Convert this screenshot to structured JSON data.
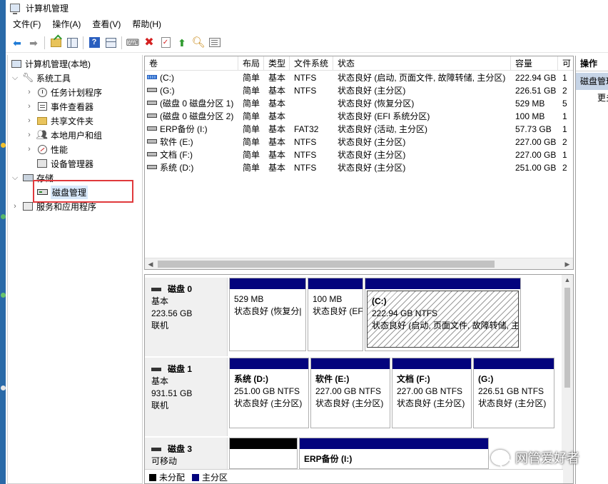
{
  "window": {
    "title": "计算机管理"
  },
  "menu": [
    "文件(F)",
    "操作(A)",
    "查看(V)",
    "帮助(H)"
  ],
  "toolbar": {
    "icons": [
      "back-arrow-icon",
      "forward-arrow-icon",
      "up-folder-icon",
      "show-hide-tree-icon",
      "help-icon",
      "show-action-pane-icon",
      "connect-icon",
      "delete-icon",
      "check-icon",
      "up-icon",
      "search-icon",
      "properties-icon"
    ]
  },
  "tree": {
    "root": "计算机管理(本地)",
    "system_tools": "系统工具",
    "task_scheduler": "任务计划程序",
    "event_viewer": "事件查看器",
    "shared_folders": "共享文件夹",
    "local_users": "本地用户和组",
    "performance": "性能",
    "device_manager": "设备管理器",
    "storage": "存储",
    "disk_management": "磁盘管理",
    "services": "服务和应用程序"
  },
  "volume_table": {
    "columns": [
      "卷",
      "布局",
      "类型",
      "文件系统",
      "状态",
      "容量",
      "可"
    ],
    "rows": [
      {
        "vol": "(C:)",
        "layout": "简单",
        "type": "基本",
        "fs": "NTFS",
        "status": "状态良好 (启动, 页面文件, 故障转储, 主分区)",
        "cap": "222.94 GB",
        "free": "1"
      },
      {
        "vol": "(G:)",
        "layout": "简单",
        "type": "基本",
        "fs": "NTFS",
        "status": "状态良好 (主分区)",
        "cap": "226.51 GB",
        "free": "2"
      },
      {
        "vol": "(磁盘 0 磁盘分区 1)",
        "layout": "简单",
        "type": "基本",
        "fs": "",
        "status": "状态良好 (恢复分区)",
        "cap": "529 MB",
        "free": "5"
      },
      {
        "vol": "(磁盘 0 磁盘分区 2)",
        "layout": "简单",
        "type": "基本",
        "fs": "",
        "status": "状态良好 (EFI 系统分区)",
        "cap": "100 MB",
        "free": "1"
      },
      {
        "vol": "ERP备份 (I:)",
        "layout": "简单",
        "type": "基本",
        "fs": "FAT32",
        "status": "状态良好 (活动, 主分区)",
        "cap": "57.73 GB",
        "free": "1"
      },
      {
        "vol": "软件 (E:)",
        "layout": "简单",
        "type": "基本",
        "fs": "NTFS",
        "status": "状态良好 (主分区)",
        "cap": "227.00 GB",
        "free": "2"
      },
      {
        "vol": "文档 (F:)",
        "layout": "简单",
        "type": "基本",
        "fs": "NTFS",
        "status": "状态良好 (主分区)",
        "cap": "227.00 GB",
        "free": "1"
      },
      {
        "vol": "系统 (D:)",
        "layout": "简单",
        "type": "基本",
        "fs": "NTFS",
        "status": "状态良好 (主分区)",
        "cap": "251.00 GB",
        "free": "2"
      }
    ]
  },
  "disks": [
    {
      "name": "磁盘 0",
      "kind": "基本",
      "size": "223.56 GB",
      "state": "联机",
      "partitions": [
        {
          "label": "",
          "size": "529 MB",
          "status": "状态良好 (恢复分|"
        },
        {
          "label": "",
          "size": "100 MB",
          "status": "状态良好 (EFI"
        },
        {
          "label": "(C:)",
          "size": "222.94 GB NTFS",
          "status": "状态良好 (启动, 页面文件, 故障转储, 主"
        }
      ]
    },
    {
      "name": "磁盘 1",
      "kind": "基本",
      "size": "931.51 GB",
      "state": "联机",
      "partitions": [
        {
          "label": "系统  (D:)",
          "size": "251.00 GB NTFS",
          "status": "状态良好 (主分区)"
        },
        {
          "label": "软件  (E:)",
          "size": "227.00 GB NTFS",
          "status": "状态良好 (主分区)"
        },
        {
          "label": "文档  (F:)",
          "size": "227.00 GB NTFS",
          "status": "状态良好 (主分区)"
        },
        {
          "label": "(G:)",
          "size": "226.51 GB NTFS",
          "status": "状态良好 (主分区)"
        }
      ]
    },
    {
      "name": "磁盘 3",
      "kind": "可移动",
      "size": "",
      "state": "",
      "partitions": [
        {
          "label": "",
          "size": "",
          "status": ""
        },
        {
          "label": "ERP备份  (I:)",
          "size": "",
          "status": ""
        }
      ]
    }
  ],
  "legend": {
    "unallocated": "未分配",
    "primary": "主分区",
    "unallocated_color": "#000000",
    "primary_color": "#03037d"
  },
  "actions": {
    "title": "操作",
    "section": "磁盘管理",
    "more": "更多操作"
  },
  "watermark": "网管爱好者",
  "colors": {
    "partition_bar": "#03037d",
    "highlight": "#e0393c",
    "selection": "#c6d4e6"
  }
}
